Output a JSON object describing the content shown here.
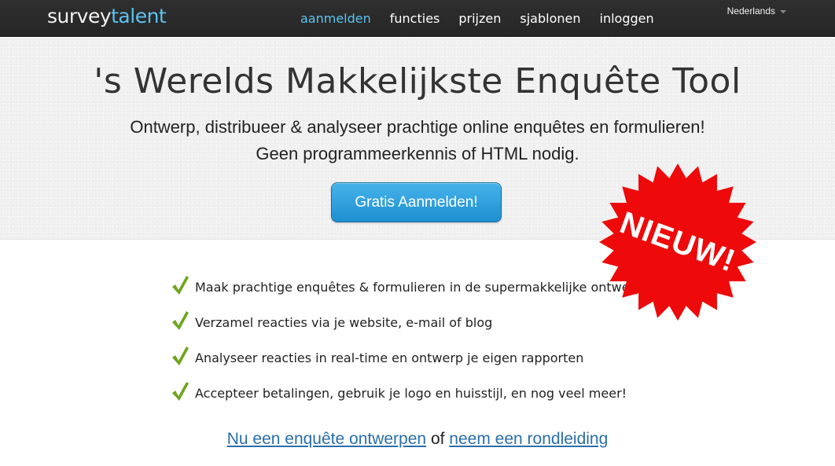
{
  "brand": {
    "name_part1": "survey",
    "name_part2": "talent"
  },
  "nav": {
    "items": [
      {
        "label": "aanmelden",
        "active": true
      },
      {
        "label": "functies"
      },
      {
        "label": "prijzen"
      },
      {
        "label": "sjablonen"
      },
      {
        "label": "inloggen"
      }
    ],
    "language": "Nederlands"
  },
  "hero": {
    "title": "'s Werelds Makkelijkste Enquête Tool",
    "subtitle_line1": "Ontwerp, distribueer & analyseer prachtige online enquêtes en formulieren!",
    "subtitle_line2": "Geen programmeerkennis of HTML nodig.",
    "cta_label": "Gratis Aanmelden!"
  },
  "badge": {
    "text": "NIEUW!",
    "color": "#ee0a0a"
  },
  "features": [
    "Maak prachtige enquêtes & formulieren in de supermakkelijke ontwerper",
    "Verzamel reacties via je website, e-mail of blog",
    "Analyseer reacties in real-time en ontwerp je eigen rapporten",
    "Accepteer betalingen, gebruik je logo en huisstijl, en nog veel meer!"
  ],
  "bottom": {
    "link1": "Nu een enquête ontwerpen",
    "connector": "of",
    "link2": "neem een rondleiding"
  },
  "colors": {
    "accent": "#5cc3f0",
    "button": "#1e8fd0",
    "check": "#6ea51e",
    "link": "#2a6eaa"
  },
  "icons": {
    "check": "checkmark-icon",
    "caret": "chevron-down-icon"
  }
}
